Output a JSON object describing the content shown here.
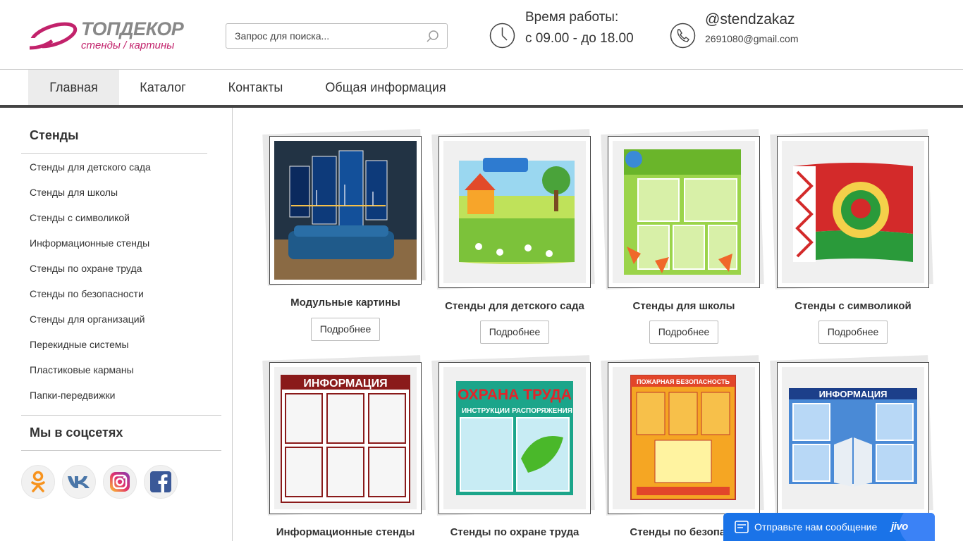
{
  "header": {
    "logo_title": "ТОПДЕКОР",
    "logo_subtitle": "стенды / картины",
    "search_placeholder": "Запрос для поиска...",
    "hours_label": "Время работы:",
    "hours_value": "с 09.00 - до 18.00",
    "contact_name": "@stendzakaz",
    "contact_email": "2691080@gmail.com"
  },
  "nav": {
    "items": [
      {
        "label": "Главная",
        "active": true
      },
      {
        "label": "Каталог"
      },
      {
        "label": "Контакты"
      },
      {
        "label": "Общая информация"
      }
    ]
  },
  "sidebar": {
    "heading": "Стенды",
    "items": [
      {
        "label": "Стенды для детского сада"
      },
      {
        "label": "Стенды для школы"
      },
      {
        "label": "Стенды с символикой"
      },
      {
        "label": "Информационные стенды"
      },
      {
        "label": "Стенды по охране труда"
      },
      {
        "label": "Стенды по безопасности"
      },
      {
        "label": "Стенды для организаций"
      },
      {
        "label": "Перекидные системы"
      },
      {
        "label": "Пластиковые карманы"
      },
      {
        "label": "Папки-передвижки"
      }
    ],
    "social_heading": "Мы в соцсетях",
    "social": [
      {
        "icon": "odnoklassniki-icon",
        "color": "#f7931e"
      },
      {
        "icon": "vk-icon",
        "color": "#4a76a8"
      },
      {
        "icon": "instagram-icon",
        "color": "#d6249f"
      },
      {
        "icon": "facebook-icon",
        "color": "#3b5998"
      }
    ]
  },
  "catalog": {
    "button_label": "Подробнее",
    "cards": [
      {
        "title": "Модульные картины"
      },
      {
        "title": "Стенды для детского сада"
      },
      {
        "title": "Стенды для школы"
      },
      {
        "title": "Стенды с символикой"
      },
      {
        "title": "Информационные стенды",
        "image_text": "ИНФОРМАЦИЯ"
      },
      {
        "title": "Стенды по охране труда",
        "image_text": "ОХРАНА ТРУДА",
        "image_subtext_left": "ИНСТРУКЦИИ",
        "image_subtext_right": "РАСПОРЯЖЕНИЯ"
      },
      {
        "title": "Стенды по безопасн",
        "image_text": "ПОЖАРНАЯ БЕЗОПАСНОСТЬ"
      },
      {
        "title": "",
        "image_text": "ИНФОРМАЦИЯ"
      }
    ]
  },
  "chat": {
    "label": "Отправьте нам сообщение",
    "brand": "jivo"
  },
  "colors": {
    "brand_pink": "#c2226b",
    "nav_border": "#444444",
    "chat_blue": "#1a73e8"
  }
}
